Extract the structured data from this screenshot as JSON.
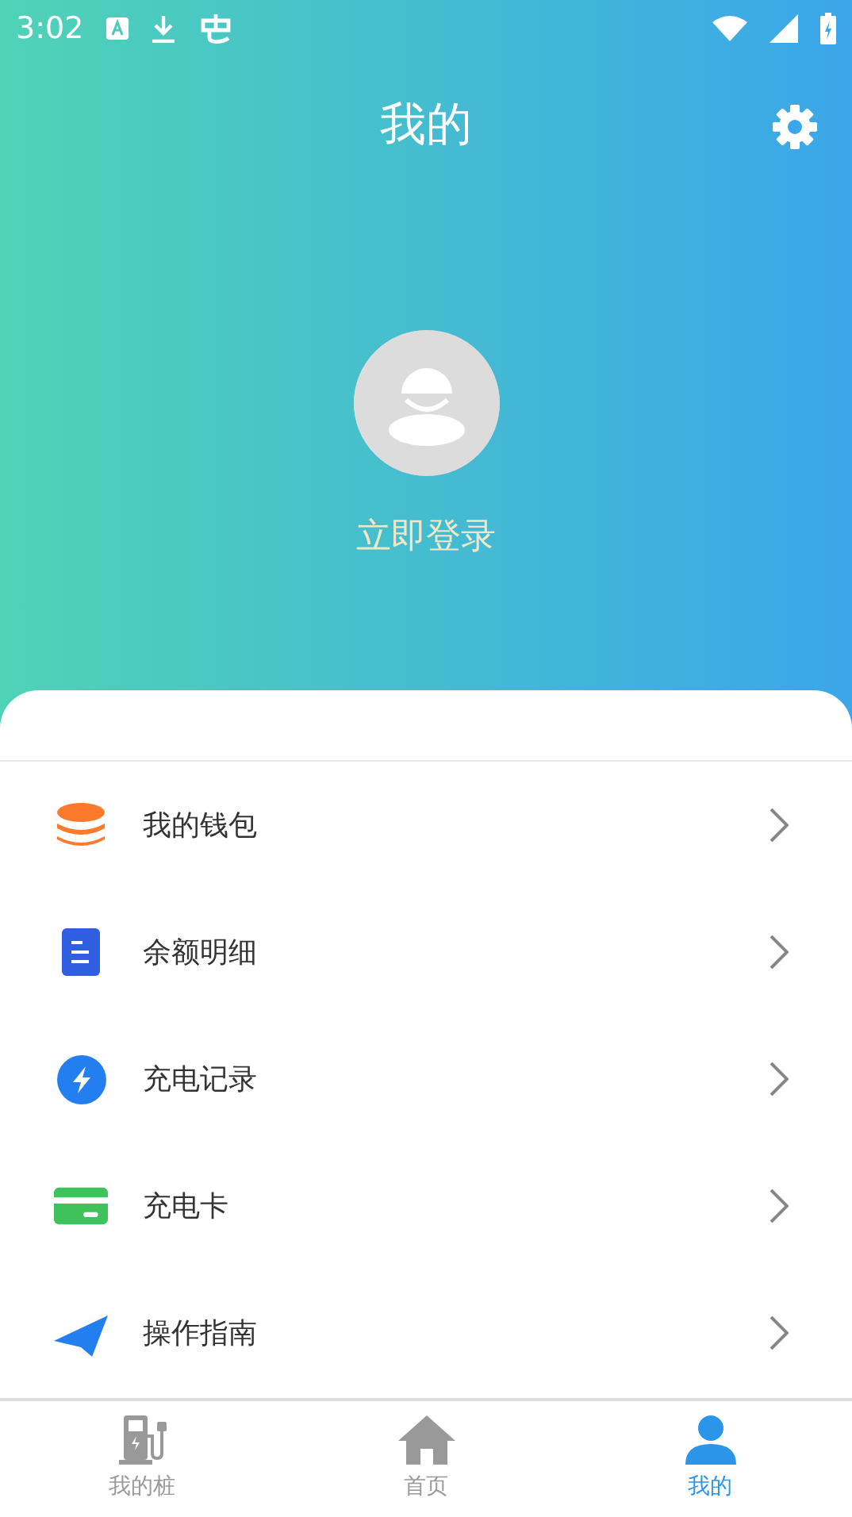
{
  "status_bar": {
    "time": "3:02"
  },
  "header": {
    "title": "我的"
  },
  "profile": {
    "login_label": "立即登录"
  },
  "menu": [
    {
      "kind": "coins",
      "label": "我的钱包"
    },
    {
      "kind": "document",
      "label": "余额明细"
    },
    {
      "kind": "bolt",
      "label": "充电记录"
    },
    {
      "kind": "card",
      "label": "充电卡"
    },
    {
      "kind": "plane",
      "label": "操作指南"
    }
  ],
  "tab_bar": [
    {
      "kind": "charger",
      "label": "我的桩",
      "selected": false
    },
    {
      "kind": "home",
      "label": "首页",
      "selected": false
    },
    {
      "kind": "person",
      "label": "我的",
      "selected": true
    }
  ]
}
